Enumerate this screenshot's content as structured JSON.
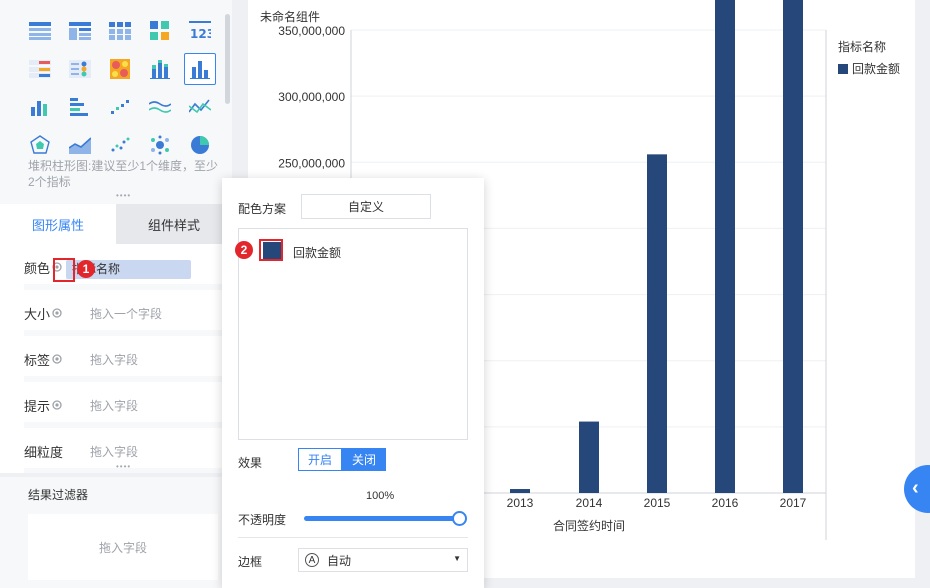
{
  "left_panel": {
    "chart_hint": "堆积柱形图:建议至少1个维度，至少2个指标",
    "tabs": [
      {
        "label": "图形属性"
      },
      {
        "label": "组件样式"
      }
    ],
    "props": {
      "color": {
        "label": "颜色",
        "value": "指标名称"
      },
      "size": {
        "label": "大小",
        "placeholder": "拖入一个字段"
      },
      "label": {
        "label": "标签",
        "placeholder": "拖入字段"
      },
      "tooltip": {
        "label": "提示",
        "placeholder": "拖入字段"
      },
      "granularity": {
        "label": "细粒度",
        "placeholder": "拖入字段"
      }
    },
    "filter": {
      "title": "结果过滤器",
      "placeholder": "拖入字段"
    },
    "badges": [
      "1",
      "2"
    ]
  },
  "chart_panel": {
    "title": "未命名组件",
    "legend": {
      "title": "指标名称",
      "items": [
        "回款金额"
      ]
    }
  },
  "popover": {
    "scheme_label": "配色方案",
    "scheme_value": "自定义",
    "series": [
      {
        "name": "回款金额",
        "color": "#26477a"
      }
    ],
    "effect_label": "效果",
    "effect_on": "开启",
    "effect_off": "关闭",
    "opacity_label": "不透明度",
    "opacity_value": "100%",
    "opacity": 1.0,
    "border_label": "边框",
    "border_value": "自动",
    "border_icon": "Ⓐ"
  },
  "chart_data": {
    "type": "bar",
    "categories": [
      "2013",
      "2014",
      "2015",
      "2016",
      "2017"
    ],
    "values": [
      3000000,
      54000000,
      256000000,
      590000000,
      437000000
    ],
    "ylim": [
      0,
      350000000
    ],
    "yticks": [
      "350,000,000",
      "300,000,000",
      "250,000,000"
    ],
    "ytick_values": [
      350000000,
      300000000,
      250000000
    ],
    "xlabel": "合同签约时间",
    "bar_color": "#26477a",
    "grid": true,
    "legend_position": "top-right"
  },
  "colors": {
    "accent": "#3685f2",
    "bar": "#26477a",
    "alert": "#e3262b"
  }
}
